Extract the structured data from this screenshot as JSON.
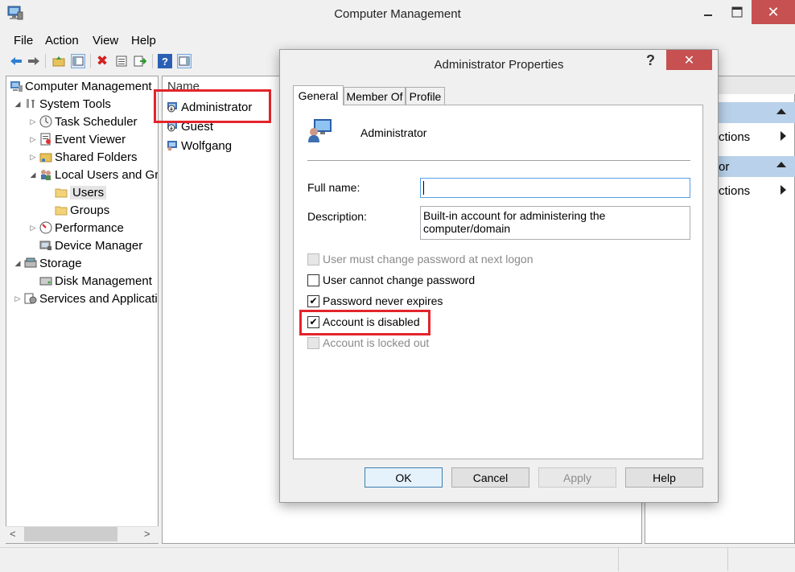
{
  "window": {
    "title": "Computer Management",
    "close_label": "✕"
  },
  "menu": [
    "File",
    "Action",
    "View",
    "Help"
  ],
  "toolbar": {
    "icons": [
      "back-icon",
      "forward-icon",
      "up-folder-icon",
      "show-hide-tree-icon",
      "delete-icon",
      "properties-icon",
      "export-list-icon",
      "help-icon",
      "show-hide-action-pane-icon"
    ]
  },
  "tree": [
    {
      "label": "Computer Management",
      "icon": "computer-management-icon",
      "expander": ""
    },
    {
      "label": "System Tools",
      "icon": "tools-icon",
      "expander": "◢"
    },
    {
      "label": "Task Scheduler",
      "icon": "clock-icon",
      "expander": "▷"
    },
    {
      "label": "Event Viewer",
      "icon": "event-viewer-icon",
      "expander": "▷"
    },
    {
      "label": "Shared Folders",
      "icon": "shared-folder-icon",
      "expander": "▷"
    },
    {
      "label": "Local Users and Groups",
      "icon": "users-icon",
      "expander": "◢"
    },
    {
      "label": "Users",
      "icon": "folder-icon",
      "expander": ""
    },
    {
      "label": "Groups",
      "icon": "folder-icon",
      "expander": ""
    },
    {
      "label": "Performance",
      "icon": "performance-icon",
      "expander": "▷"
    },
    {
      "label": "Device Manager",
      "icon": "device-manager-icon",
      "expander": ""
    },
    {
      "label": "Storage",
      "icon": "storage-icon",
      "expander": "◢"
    },
    {
      "label": "Disk Management",
      "icon": "disk-icon",
      "expander": ""
    },
    {
      "label": "Services and Applications",
      "icon": "services-icon",
      "expander": "▷"
    }
  ],
  "list": {
    "header": "Name",
    "items": [
      "Administrator",
      "Guest",
      "Wolfgang"
    ]
  },
  "actions": {
    "item1": "ctions",
    "section2": "or",
    "item2": "ctions"
  },
  "dialog": {
    "title": "Administrator Properties",
    "help_glyph": "?",
    "close_glyph": "✕",
    "tabs": [
      "General",
      "Member Of",
      "Profile"
    ],
    "user_name": "Administrator",
    "full_name_label": "Full name:",
    "full_name_value": "",
    "description_label": "Description:",
    "description_value": "Built-in account for administering the computer/domain",
    "checkboxes": [
      {
        "label": "User must change password at next logon",
        "checked": false,
        "enabled": false
      },
      {
        "label": "User cannot change password",
        "checked": false,
        "enabled": true
      },
      {
        "label": "Password never expires",
        "checked": true,
        "enabled": true
      },
      {
        "label": "Account is disabled",
        "checked": true,
        "enabled": true
      },
      {
        "label": "Account is locked out",
        "checked": false,
        "enabled": false
      }
    ],
    "buttons": {
      "ok": "OK",
      "cancel": "Cancel",
      "apply": "Apply",
      "help": "Help"
    },
    "check_glyph": "✔"
  },
  "colors": {
    "highlight_red": "#e3242b",
    "close_red": "#c75050",
    "action_section_blue": "#b9d1ea"
  }
}
